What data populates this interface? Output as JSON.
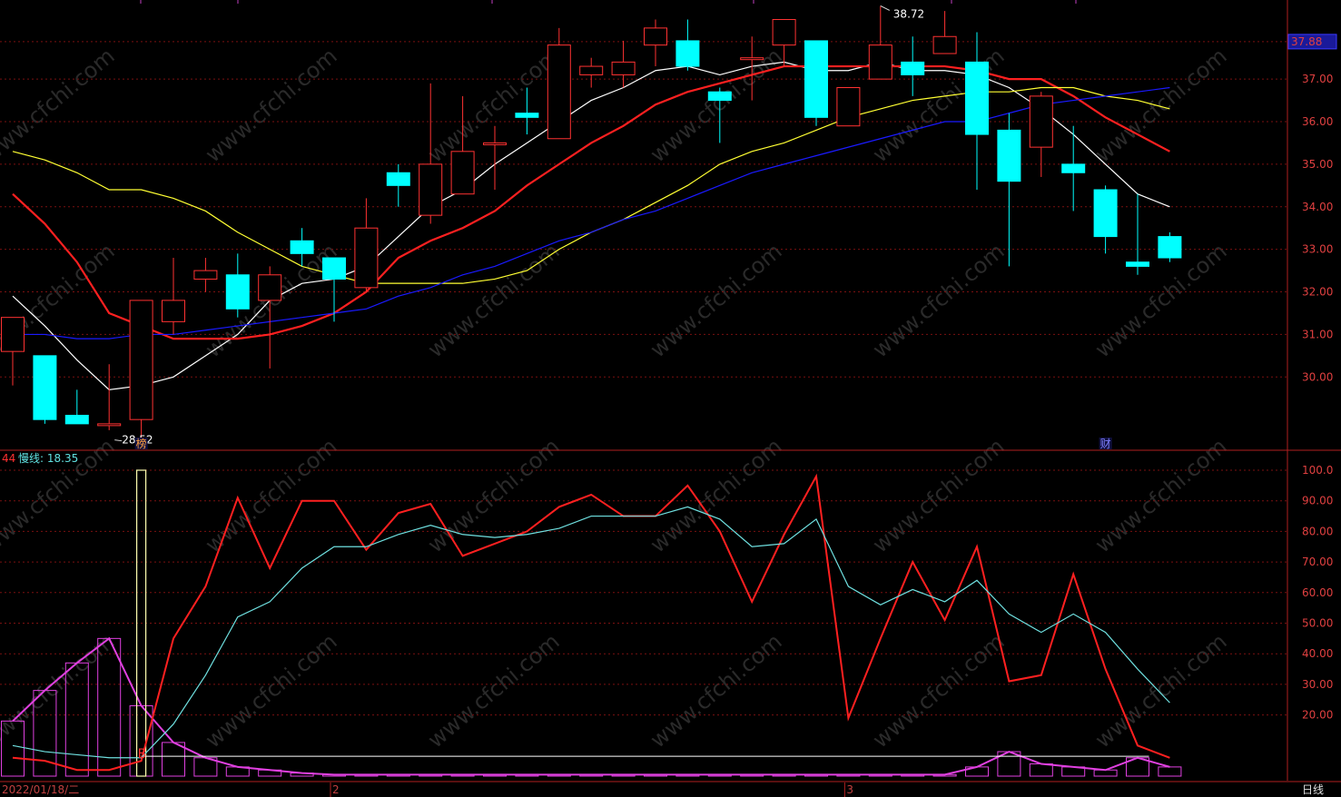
{
  "chart_data": [
    {
      "type": "candlestick",
      "title": "",
      "ylim": [
        28.3,
        38.7
      ],
      "y_ticks": [
        "37.00",
        "36.00",
        "35.00",
        "34.00",
        "33.00",
        "32.00",
        "31.00",
        "30.00"
      ],
      "y_tick_values": [
        37,
        36,
        35,
        34,
        33,
        32,
        31,
        30
      ],
      "price_badge": "37.88",
      "price_badge_value": 37.88,
      "high_label": "38.72",
      "low_label": "28.52",
      "markers": [
        {
          "index": 4,
          "text": "榜"
        },
        {
          "index": 34,
          "text": "财"
        }
      ],
      "candles": [
        {
          "o": 30.6,
          "h": 31.4,
          "l": 29.8,
          "c": 31.4
        },
        {
          "o": 30.5,
          "h": 30.5,
          "l": 28.9,
          "c": 29.0
        },
        {
          "o": 29.1,
          "h": 29.7,
          "l": 28.9,
          "c": 28.9
        },
        {
          "o": 28.9,
          "h": 30.3,
          "l": 28.75,
          "c": 28.9
        },
        {
          "o": 29.0,
          "h": 31.8,
          "l": 28.52,
          "c": 31.8
        },
        {
          "o": 31.3,
          "h": 32.8,
          "l": 31.0,
          "c": 31.8
        },
        {
          "o": 32.3,
          "h": 32.8,
          "l": 32.0,
          "c": 32.5
        },
        {
          "o": 32.4,
          "h": 32.9,
          "l": 31.4,
          "c": 31.6
        },
        {
          "o": 31.8,
          "h": 32.6,
          "l": 30.2,
          "c": 32.4
        },
        {
          "o": 33.2,
          "h": 33.5,
          "l": 32.6,
          "c": 32.9
        },
        {
          "o": 32.8,
          "h": 32.8,
          "l": 31.3,
          "c": 32.3
        },
        {
          "o": 32.1,
          "h": 34.2,
          "l": 32.0,
          "c": 33.5
        },
        {
          "o": 34.8,
          "h": 35.0,
          "l": 34.0,
          "c": 34.5
        },
        {
          "o": 33.8,
          "h": 36.9,
          "l": 33.6,
          "c": 35.0
        },
        {
          "o": 34.3,
          "h": 36.6,
          "l": 34.3,
          "c": 35.3
        },
        {
          "o": 35.5,
          "h": 35.9,
          "l": 34.4,
          "c": 35.5
        },
        {
          "o": 36.2,
          "h": 36.8,
          "l": 35.7,
          "c": 36.1
        },
        {
          "o": 35.6,
          "h": 38.2,
          "l": 35.6,
          "c": 37.8
        },
        {
          "o": 37.1,
          "h": 37.5,
          "l": 36.8,
          "c": 37.3
        },
        {
          "o": 37.1,
          "h": 37.9,
          "l": 36.8,
          "c": 37.4
        },
        {
          "o": 37.8,
          "h": 38.4,
          "l": 37.3,
          "c": 38.2
        },
        {
          "o": 37.9,
          "h": 38.4,
          "l": 37.2,
          "c": 37.3
        },
        {
          "o": 36.7,
          "h": 36.8,
          "l": 35.5,
          "c": 36.5
        },
        {
          "o": 37.5,
          "h": 38.0,
          "l": 36.5,
          "c": 37.5
        },
        {
          "o": 37.8,
          "h": 38.3,
          "l": 37.3,
          "c": 38.4
        },
        {
          "o": 37.9,
          "h": 37.9,
          "l": 35.9,
          "c": 36.1
        },
        {
          "o": 35.9,
          "h": 36.7,
          "l": 35.9,
          "c": 36.8
        },
        {
          "o": 37.0,
          "h": 38.72,
          "l": 37.0,
          "c": 37.8
        },
        {
          "o": 37.4,
          "h": 38.0,
          "l": 36.6,
          "c": 37.1
        },
        {
          "o": 37.6,
          "h": 38.6,
          "l": 37.6,
          "c": 38.0
        },
        {
          "o": 37.4,
          "h": 38.1,
          "l": 34.4,
          "c": 35.7
        },
        {
          "o": 35.8,
          "h": 36.2,
          "l": 32.6,
          "c": 34.6
        },
        {
          "o": 35.4,
          "h": 36.7,
          "l": 34.7,
          "c": 36.6
        },
        {
          "o": 35.0,
          "h": 35.9,
          "l": 33.9,
          "c": 34.8
        },
        {
          "o": 34.4,
          "h": 34.5,
          "l": 32.9,
          "c": 33.3
        },
        {
          "o": 32.7,
          "h": 34.3,
          "l": 32.4,
          "c": 32.6
        },
        {
          "o": 33.3,
          "h": 33.4,
          "l": 32.7,
          "c": 32.8
        }
      ],
      "series": [
        {
          "color": "#ffffff",
          "values": [
            31.9,
            31.2,
            30.4,
            29.7,
            29.8,
            30.0,
            30.5,
            31.0,
            31.8,
            32.2,
            32.3,
            32.6,
            33.3,
            34.0,
            34.4,
            35.0,
            35.5,
            36.0,
            36.5,
            36.8,
            37.2,
            37.3,
            37.1,
            37.3,
            37.4,
            37.2,
            37.2,
            37.4,
            37.2,
            37.2,
            37.1,
            36.8,
            36.3,
            35.7,
            35.0,
            34.3,
            34.0
          ]
        },
        {
          "color": "#ff2020",
          "values": [
            34.3,
            33.6,
            32.7,
            31.5,
            31.2,
            30.9,
            30.9,
            30.9,
            31.0,
            31.2,
            31.5,
            32.0,
            32.8,
            33.2,
            33.5,
            33.9,
            34.5,
            35.0,
            35.5,
            35.9,
            36.4,
            36.7,
            36.9,
            37.1,
            37.3,
            37.3,
            37.3,
            37.3,
            37.3,
            37.3,
            37.2,
            37.0,
            37.0,
            36.6,
            36.1,
            35.7,
            35.3
          ]
        },
        {
          "color": "#ffff33",
          "values": [
            35.3,
            35.1,
            34.8,
            34.4,
            34.4,
            34.2,
            33.9,
            33.4,
            33.0,
            32.6,
            32.4,
            32.2,
            32.2,
            32.2,
            32.2,
            32.3,
            32.5,
            33.0,
            33.4,
            33.7,
            34.1,
            34.5,
            35.0,
            35.3,
            35.5,
            35.8,
            36.1,
            36.3,
            36.5,
            36.6,
            36.7,
            36.7,
            36.8,
            36.8,
            36.6,
            36.5,
            36.3
          ]
        },
        {
          "color": "#1a1aff",
          "values": [
            31.0,
            31.0,
            30.9,
            30.9,
            31.0,
            31.0,
            31.1,
            31.2,
            31.3,
            31.4,
            31.5,
            31.6,
            31.9,
            32.1,
            32.4,
            32.6,
            32.9,
            33.2,
            33.4,
            33.7,
            33.9,
            34.2,
            34.5,
            34.8,
            35.0,
            35.2,
            35.4,
            35.6,
            35.8,
            36.0,
            36.0,
            36.2,
            36.4,
            36.5,
            36.6,
            36.7,
            36.8
          ]
        }
      ]
    },
    {
      "type": "line",
      "legend": {
        "prefix": "44",
        "slow_label": "慢线: 18.35"
      },
      "ylim": [
        0,
        100
      ],
      "y_ticks": [
        "100.0",
        "90.00",
        "80.00",
        "70.00",
        "60.00",
        "50.00",
        "40.00",
        "30.00",
        "20.00"
      ],
      "y_tick_values": [
        100,
        90,
        80,
        70,
        60,
        50,
        40,
        30,
        20
      ],
      "marker": {
        "index": 4,
        "text": "B"
      },
      "highlight_bar": {
        "index": 4,
        "value": 100
      },
      "baseline_value": 6.5,
      "bars": [
        18,
        28,
        37,
        45,
        23,
        11,
        6,
        3,
        2,
        1,
        0.5,
        0.5,
        0.5,
        0.5,
        0.5,
        0.5,
        0.5,
        0.5,
        0.5,
        0.5,
        0.5,
        0.5,
        0.5,
        0.5,
        0.5,
        0.5,
        0.5,
        0.5,
        0.5,
        0.5,
        3,
        8,
        4,
        3,
        2,
        6,
        3
      ],
      "series": [
        {
          "name": "",
          "color": "#ff2020",
          "values": [
            6,
            5,
            2,
            2,
            5,
            45,
            62,
            91,
            68,
            90,
            90,
            74,
            86,
            89,
            72,
            76,
            80,
            88,
            92,
            85,
            85,
            95,
            80,
            57,
            79,
            98,
            19,
            45,
            70,
            51,
            75,
            31,
            33,
            66,
            35,
            10,
            6
          ]
        },
        {
          "name": "慢线",
          "color": "#6fe0e0",
          "values": [
            10,
            8,
            7,
            6,
            6,
            17,
            33,
            52,
            57,
            68,
            75,
            75,
            79,
            82,
            79,
            78,
            79,
            81,
            85,
            85,
            85,
            88,
            84,
            75,
            76,
            84,
            62,
            56,
            61,
            57,
            64,
            53,
            47,
            53,
            47,
            35,
            24
          ]
        }
      ]
    }
  ],
  "x_axis": {
    "labels": [
      {
        "index": 0,
        "text": "2022/01/18/二"
      },
      {
        "index": 10,
        "text": "2"
      },
      {
        "index": 26,
        "text": "3"
      }
    ]
  },
  "period_label": "日线",
  "watermark": "www.cfchi.com"
}
